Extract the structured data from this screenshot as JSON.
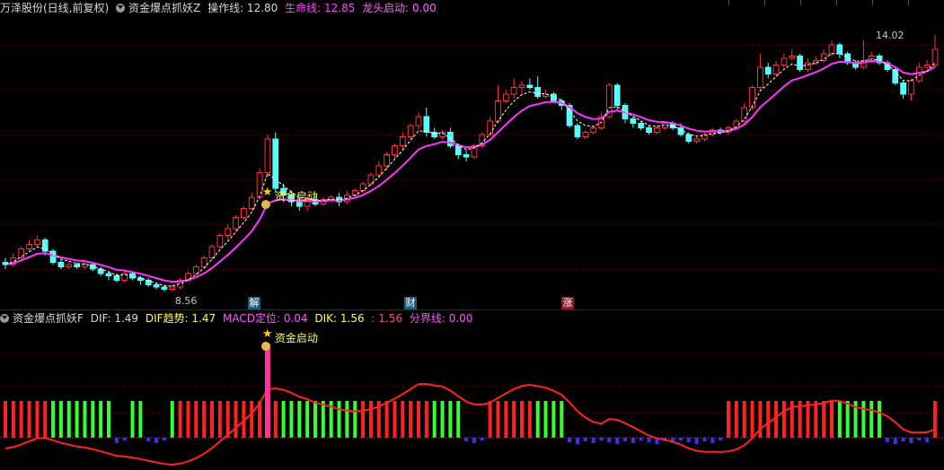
{
  "top_panel": {
    "app_name": "万泽股份(日线,前复权)",
    "indicator_name": "资金爆点抓妖Z",
    "op_line_label": "操作线: 12.80",
    "life_line_label": "生命线: 12.85",
    "dragon_label": "龙头启动: 0.00"
  },
  "bottom_panel": {
    "indicator_name": "资金爆点抓妖F",
    "dif_label": "DIF: 1.49",
    "dif_trend_label": "DIF趋势: 1.47",
    "macd_label": "MACD定位: 0.04",
    "dik_label": "DIK: 1.56",
    "extra_label": ": 1.56",
    "boundary_label": "分界线: 0.00"
  },
  "annotations": {
    "high_price": "14.02",
    "low_price": "8.56",
    "signal_top": "资金启动",
    "signal_bottom": "资金启动",
    "marker_jie": "解",
    "marker_cai": "财",
    "marker_zhang": "涨"
  },
  "colors": {
    "up": "#ff3333",
    "down": "#54ffff",
    "life_line": "#ff33ff",
    "op_line": "#ffffff",
    "macd_up": "#ff2222",
    "macd_down": "#33ff33",
    "bar_neg": "#3333ff",
    "grid": "#8b0000"
  },
  "chart_data": {
    "type": "candlestick",
    "price_range": [
      8.2,
      14.4
    ],
    "candles": [
      [
        8.95,
        8.9,
        9.05,
        8.8
      ],
      [
        8.9,
        9.05,
        9.15,
        8.85
      ],
      [
        9.05,
        9.25,
        9.3,
        9.0
      ],
      [
        9.25,
        9.35,
        9.45,
        9.2
      ],
      [
        9.35,
        9.45,
        9.55,
        9.3
      ],
      [
        9.45,
        9.2,
        9.5,
        9.1
      ],
      [
        9.2,
        8.95,
        9.25,
        8.9
      ],
      [
        8.95,
        8.85,
        9.0,
        8.8
      ],
      [
        8.85,
        8.9,
        8.95,
        8.8
      ],
      [
        8.9,
        8.85,
        8.95,
        8.8
      ],
      [
        8.85,
        8.9,
        8.95,
        8.8
      ],
      [
        8.9,
        8.8,
        8.95,
        8.75
      ],
      [
        8.8,
        8.7,
        8.85,
        8.65
      ],
      [
        8.7,
        8.65,
        8.75,
        8.55
      ],
      [
        8.65,
        8.55,
        8.7,
        8.5
      ],
      [
        8.55,
        8.7,
        8.75,
        8.5
      ],
      [
        8.7,
        8.6,
        8.72,
        8.55
      ],
      [
        8.6,
        8.55,
        8.65,
        8.45
      ],
      [
        8.55,
        8.45,
        8.6,
        8.4
      ],
      [
        8.45,
        8.4,
        8.5,
        8.35
      ],
      [
        8.4,
        8.35,
        8.45,
        8.3
      ],
      [
        8.35,
        8.4,
        8.45,
        8.3
      ],
      [
        8.4,
        8.55,
        8.6,
        8.35
      ],
      [
        8.55,
        8.7,
        8.75,
        8.5
      ],
      [
        8.7,
        8.85,
        8.9,
        8.65
      ],
      [
        8.85,
        9.05,
        9.1,
        8.8
      ],
      [
        9.05,
        9.3,
        9.35,
        9.0
      ],
      [
        9.3,
        9.55,
        9.6,
        9.25
      ],
      [
        9.55,
        9.7,
        9.8,
        9.45
      ],
      [
        9.7,
        9.95,
        10.0,
        9.65
      ],
      [
        9.95,
        10.15,
        10.2,
        9.9
      ],
      [
        10.15,
        10.4,
        10.5,
        10.1
      ],
      [
        10.4,
        10.95,
        11.05,
        10.35
      ],
      [
        10.95,
        11.7,
        11.8,
        10.85
      ],
      [
        11.7,
        10.6,
        11.85,
        10.5
      ],
      [
        10.6,
        10.45,
        10.7,
        10.3
      ],
      [
        10.45,
        10.3,
        10.55,
        10.2
      ],
      [
        10.3,
        10.2,
        10.4,
        10.1
      ],
      [
        10.2,
        10.35,
        10.45,
        10.1
      ],
      [
        10.35,
        10.25,
        10.45,
        10.2
      ],
      [
        10.25,
        10.35,
        10.4,
        10.2
      ],
      [
        10.35,
        10.4,
        10.45,
        10.3
      ],
      [
        10.4,
        10.3,
        10.5,
        10.2
      ],
      [
        10.3,
        10.45,
        10.55,
        10.25
      ],
      [
        10.45,
        10.55,
        10.6,
        10.4
      ],
      [
        10.55,
        10.7,
        10.75,
        10.5
      ],
      [
        10.7,
        10.9,
        10.95,
        10.65
      ],
      [
        10.9,
        11.1,
        11.2,
        10.85
      ],
      [
        11.1,
        11.35,
        11.4,
        11.0
      ],
      [
        11.35,
        11.55,
        11.6,
        11.25
      ],
      [
        11.55,
        11.75,
        11.85,
        11.45
      ],
      [
        11.75,
        12.0,
        12.05,
        11.7
      ],
      [
        12.0,
        12.2,
        12.3,
        11.9
      ],
      [
        12.2,
        11.85,
        12.4,
        11.75
      ],
      [
        11.85,
        11.75,
        11.95,
        11.7
      ],
      [
        11.75,
        11.85,
        11.9,
        11.7
      ],
      [
        11.85,
        11.55,
        11.95,
        11.5
      ],
      [
        11.55,
        11.35,
        11.6,
        11.25
      ],
      [
        11.35,
        11.3,
        11.45,
        11.2
      ],
      [
        11.3,
        11.55,
        11.6,
        11.25
      ],
      [
        11.55,
        11.8,
        11.85,
        11.5
      ],
      [
        11.8,
        12.1,
        12.2,
        11.75
      ],
      [
        12.1,
        12.55,
        12.9,
        12.05
      ],
      [
        12.55,
        12.7,
        12.8,
        12.5
      ],
      [
        12.7,
        12.85,
        13.05,
        12.6
      ],
      [
        12.85,
        12.9,
        13.0,
        12.7
      ],
      [
        12.9,
        12.85,
        13.05,
        12.8
      ],
      [
        12.85,
        12.65,
        13.1,
        12.6
      ],
      [
        12.65,
        12.7,
        12.8,
        12.6
      ],
      [
        12.7,
        12.55,
        12.75,
        12.5
      ],
      [
        12.55,
        12.45,
        12.6,
        12.35
      ],
      [
        12.45,
        12.0,
        12.5,
        11.95
      ],
      [
        12.0,
        11.75,
        12.05,
        11.7
      ],
      [
        11.75,
        11.85,
        11.9,
        11.7
      ],
      [
        11.85,
        11.95,
        12.0,
        11.8
      ],
      [
        11.95,
        12.2,
        12.3,
        11.9
      ],
      [
        12.2,
        12.9,
        12.95,
        12.15
      ],
      [
        12.9,
        12.45,
        12.95,
        12.35
      ],
      [
        12.45,
        12.15,
        12.5,
        12.05
      ],
      [
        12.15,
        12.05,
        12.2,
        11.95
      ],
      [
        12.05,
        11.95,
        12.1,
        11.9
      ],
      [
        11.95,
        11.85,
        12.0,
        11.8
      ],
      [
        11.85,
        11.95,
        12.0,
        11.8
      ],
      [
        11.95,
        12.05,
        12.1,
        11.9
      ],
      [
        12.05,
        11.95,
        12.1,
        11.9
      ],
      [
        11.95,
        11.8,
        12.05,
        11.75
      ],
      [
        11.8,
        11.65,
        11.85,
        11.6
      ],
      [
        11.65,
        11.7,
        11.75,
        11.6
      ],
      [
        11.7,
        11.8,
        11.85,
        11.65
      ],
      [
        11.8,
        11.9,
        11.95,
        11.75
      ],
      [
        11.9,
        11.85,
        11.95,
        11.8
      ],
      [
        11.85,
        11.95,
        12.0,
        11.8
      ],
      [
        11.95,
        12.1,
        12.15,
        11.9
      ],
      [
        12.1,
        12.4,
        12.5,
        12.05
      ],
      [
        12.4,
        12.85,
        12.9,
        12.35
      ],
      [
        12.85,
        13.3,
        13.6,
        12.8
      ],
      [
        13.3,
        13.15,
        13.4,
        13.05
      ],
      [
        13.15,
        13.35,
        13.45,
        13.1
      ],
      [
        13.35,
        13.5,
        13.6,
        13.3
      ],
      [
        13.5,
        13.55,
        13.7,
        13.45
      ],
      [
        13.55,
        13.25,
        13.6,
        13.2
      ],
      [
        13.25,
        13.4,
        13.5,
        13.2
      ],
      [
        13.4,
        13.45,
        13.55,
        13.35
      ],
      [
        13.45,
        13.6,
        13.7,
        13.4
      ],
      [
        13.6,
        13.8,
        13.9,
        13.55
      ],
      [
        13.8,
        13.6,
        13.85,
        13.5
      ],
      [
        13.6,
        13.4,
        13.65,
        13.35
      ],
      [
        13.4,
        13.3,
        13.45,
        13.25
      ],
      [
        13.3,
        13.45,
        13.9,
        13.25
      ],
      [
        13.45,
        13.55,
        13.65,
        13.4
      ],
      [
        13.55,
        13.4,
        13.6,
        13.35
      ],
      [
        13.4,
        13.25,
        13.45,
        13.2
      ],
      [
        13.25,
        12.95,
        13.3,
        12.9
      ],
      [
        12.95,
        12.7,
        13.0,
        12.6
      ],
      [
        12.7,
        13.0,
        13.05,
        12.55
      ],
      [
        13.0,
        13.3,
        13.4,
        12.95
      ],
      [
        13.3,
        13.35,
        13.45,
        13.25
      ],
      [
        13.35,
        13.7,
        14.02,
        13.3
      ]
    ]
  }
}
